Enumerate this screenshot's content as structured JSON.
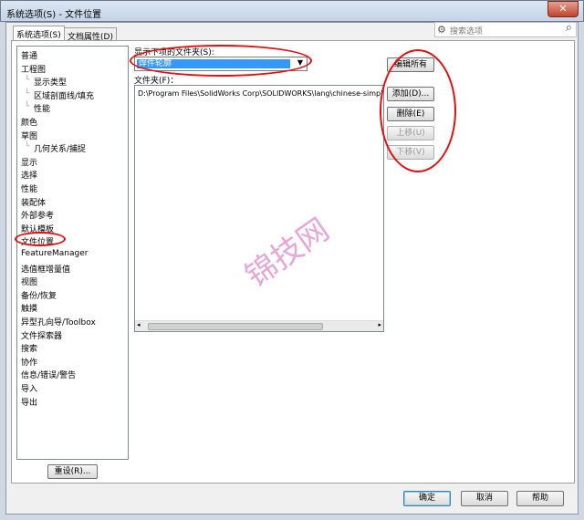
{
  "window": {
    "title": "系统选项(S) - 文件位置",
    "close": "✕"
  },
  "tabs": [
    {
      "label": "系统选项(S)",
      "active": true
    },
    {
      "label": "文档属性(D)",
      "active": false
    }
  ],
  "search": {
    "placeholder": "搜索选项",
    "icon": "gear-icon"
  },
  "tree": [
    {
      "label": "普通",
      "level": 0
    },
    {
      "label": "工程图",
      "level": 0
    },
    {
      "label": "显示类型",
      "level": 1
    },
    {
      "label": "区域剖面线/填充",
      "level": 1
    },
    {
      "label": "性能",
      "level": 1
    },
    {
      "label": "颜色",
      "level": 0
    },
    {
      "label": "草图",
      "level": 0
    },
    {
      "label": "几何关系/捕捉",
      "level": 1
    },
    {
      "label": "显示",
      "level": 0
    },
    {
      "label": "选择",
      "level": 0
    },
    {
      "label": "性能",
      "level": 0
    },
    {
      "label": "装配体",
      "level": 0
    },
    {
      "label": "外部参考",
      "level": 0
    },
    {
      "label": "默认模板",
      "level": 0
    },
    {
      "label": "文件位置",
      "level": 0,
      "selected": true
    },
    {
      "label": "FeatureManager",
      "level": 0
    },
    {
      "label": "选值框增量值",
      "level": 0
    },
    {
      "label": "视图",
      "level": 0
    },
    {
      "label": "备份/恢复",
      "level": 0
    },
    {
      "label": "触摸",
      "level": 0
    },
    {
      "label": "异型孔向导/Toolbox",
      "level": 0
    },
    {
      "label": "文件探索器",
      "level": 0
    },
    {
      "label": "搜索",
      "level": 0
    },
    {
      "label": "协作",
      "level": 0
    },
    {
      "label": "信息/错误/警告",
      "level": 0
    },
    {
      "label": "导入",
      "level": 0
    },
    {
      "label": "导出",
      "level": 0
    }
  ],
  "reset": "重设(R)...",
  "main": {
    "show_label": "显示下项的文件夹(S):",
    "combo_value": "焊件轮廓",
    "folders_label": "文件夹(F)：",
    "folders": [
      "D:\\Program Files\\SolidWorks Corp\\SOLIDWORKS\\lang\\chinese-simplified"
    ]
  },
  "buttons": {
    "edit_all": "编辑所有",
    "add": "添加(D)...",
    "delete": "删除(E)",
    "up": "上移(U)",
    "down": "下移(V)"
  },
  "footer": {
    "ok": "确定",
    "cancel": "取消",
    "help": "帮助"
  },
  "watermark": "锦技网",
  "annotation_color": "#e01010"
}
